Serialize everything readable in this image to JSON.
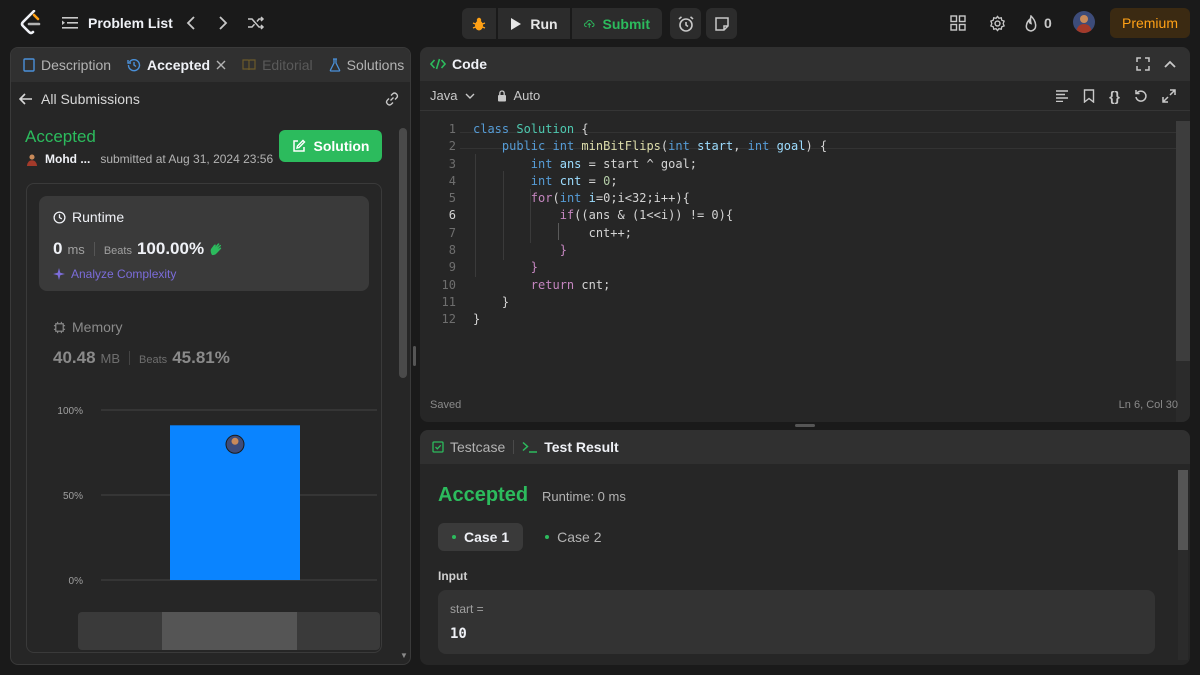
{
  "topbar": {
    "problem_list_label": "Problem List",
    "run_label": "Run",
    "submit_label": "Submit",
    "streak_count": "0",
    "premium_label": "Premium"
  },
  "left_tabs": [
    {
      "label": "Description"
    },
    {
      "label": "Accepted"
    },
    {
      "label": "Editorial"
    },
    {
      "label": "Solutions"
    }
  ],
  "submission": {
    "back_label": "All Submissions",
    "status": "Accepted",
    "user": "Mohd ...",
    "submitted_at": "submitted at Aug 31, 2024 23:56",
    "solution_label": "Solution",
    "runtime": {
      "label": "Runtime",
      "value": "0",
      "unit": "ms",
      "beats_label": "Beats",
      "beats": "100.00%",
      "analyze_label": "Analyze Complexity"
    },
    "memory": {
      "label": "Memory",
      "value": "40.48",
      "unit": "MB",
      "beats_label": "Beats",
      "beats": "45.81%"
    }
  },
  "chart_data": {
    "type": "bar",
    "y_ticks": [
      "100%",
      "50%",
      "0%"
    ],
    "ylim": [
      0,
      100
    ],
    "values": [
      91
    ]
  },
  "code_panel": {
    "title": "Code",
    "language": "Java",
    "autocomplete": "Auto",
    "status": "Saved",
    "cursor": "Ln 6, Col 30",
    "lines": [
      "class Solution {",
      "    public int minBitFlips(int start, int goal) {",
      "        int ans = start ^ goal;",
      "        int cnt = 0;",
      "        for(int i=0;i<32;i++){",
      "            if((ans & (1<<i)) != 0){",
      "                cnt++;",
      "            }",
      "        }",
      "        return cnt;",
      "    }",
      "}"
    ]
  },
  "test_panel": {
    "testcase_tab": "Testcase",
    "result_tab": "Test Result",
    "status": "Accepted",
    "runtime": "Runtime: 0 ms",
    "cases": [
      "Case 1",
      "Case 2"
    ],
    "input_label": "Input",
    "param_name": "start =",
    "param_value": "10"
  },
  "colors": {
    "accepted": "#2cbb5d",
    "bar": "#0a84ff",
    "premium": "#ffa116",
    "analyze": "#7b6cd9"
  }
}
